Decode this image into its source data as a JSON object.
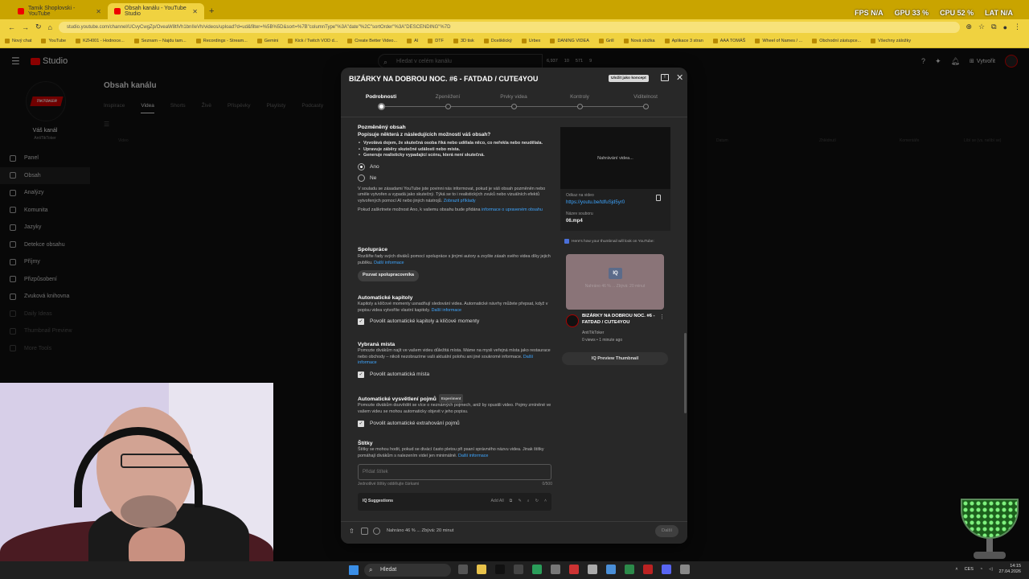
{
  "browser": {
    "tabs": [
      {
        "title": "Tamik Shoplovski - YouTube",
        "active": false
      },
      {
        "title": "Obsah kanálu - YouTube Studio",
        "active": true
      }
    ],
    "address": "studio.youtube.com/channel/UCvyCwgZp/OveaW8tlVh1bnIIeVh/videos/upload?d=ud&filter=%5B%5D&sort=%7B\"columnType\"%3A\"date\"%2C\"sortOrder\"%3A\"DESCENDING\"%7D",
    "hud": {
      "fps": "FPS N/A",
      "gpu": "GPU 33 %",
      "cpu": "CPU 52 %",
      "lat": "LAT N/A"
    },
    "bookmarks": [
      "Nový chat",
      "YouTube",
      "KZH001 - Hodnoce...",
      "Seznam – Najdu tam...",
      "Recordings - Stream...",
      "Gemini",
      "Kick / Twitch VOD d...",
      "Create Better Video...",
      "AI",
      "DTF",
      "3D tisk",
      "Dcešklický",
      "Urbex",
      "DANING VIDEA",
      "Grill",
      "Nová složka",
      "Aplikace 3 stran",
      "AAA TOMÁŠ",
      "Wheel of Names / ...",
      "Obchodní zástupce...",
      "Všechny záložky"
    ]
  },
  "studio": {
    "logo": "Studio",
    "search_placeholder": "Hledat v celém kanálu",
    "stats": [
      "6,937",
      "10",
      "571",
      "9"
    ],
    "create_label": "Vytvořit",
    "channel": {
      "label": "Váš kanál",
      "name": "AntiTikToker",
      "avatar_text": "TIKTOKER"
    },
    "nav": [
      {
        "label": "Panel"
      },
      {
        "label": "Obsah"
      },
      {
        "label": "Analýzy"
      },
      {
        "label": "Komunita"
      },
      {
        "label": "Jazyky"
      },
      {
        "label": "Detekce obsahu"
      },
      {
        "label": "Příjmy"
      },
      {
        "label": "Přizpůsobení"
      },
      {
        "label": "Zvuková knihovna"
      },
      {
        "label": "Daily Ideas"
      },
      {
        "label": "Thumbnail Preview"
      },
      {
        "label": "More Tools"
      }
    ],
    "page_title": "Obsah kanálu",
    "content_tabs": [
      "Inspirace",
      "Videa",
      "Shorts",
      "Živě",
      "Příspěvky",
      "Playlisty",
      "Podcasty"
    ],
    "table_headers": [
      "Video",
      "Datum",
      "Zhlédnutí",
      "Komentáře",
      "Líbí se (vs. nelíbí se)"
    ]
  },
  "modal": {
    "title": "BIZÁRKY NA DOBROU NOC. #6 - FATDAD / CUTE4YOU",
    "draft_badge": "Uložit jako koncept",
    "steps": [
      "Podrobnosti",
      "Zpeněžení",
      "Prvky videa",
      "Kontroly",
      "Viditelnost"
    ],
    "altered": {
      "heading": "Pozměněný obsah",
      "question": "Popisuje některá z následujících možností váš obsah?",
      "bullets": [
        "Vyvolává dojem, že skutečná osoba říká nebo udělala něco, co neřekla nebo neudělala.",
        "Upravuje záběry skutečné události nebo místa.",
        "Generuje realisticky vypadající scénu, která není skutečná."
      ],
      "yes": "Ano",
      "no": "Ne",
      "help1": "V souladu se zásadami YouTube jste povinni nás informovat, pokud je váš obsah pozměněn nebo uměle vytvořen a vypadá jako skutečný. Týká se to i realistických zvuků nebo vizuálních efektů vytvořených pomocí AI nebo jiných nástrojů.",
      "help1_link": "Zobrazit příklady",
      "help2": "Pokud zaškrtnete možnost Ano, k vašemu obsahu bude přidána",
      "help2_link": "informace o upraveném obsahu"
    },
    "collab": {
      "heading": "Spolupráce",
      "text": "Rozšiřte řady svých diváků pomocí spolupráce s jinými autory a zvyšte zásah svého videa díky jejich publiku.",
      "link": "Další informace",
      "button": "Pozvat spolupracovníka"
    },
    "chapters": {
      "heading": "Automatické kapitoly",
      "text": "Kapitoly a klíčové momenty usnadňují sledování videa. Automatické návrhy můžete přepsat, když v popisu videa vytvoříte vlastní kapitoly.",
      "link": "Další informace",
      "checkbox": "Povolit automatické kapitoly a klíčové momenty"
    },
    "places": {
      "heading": "Vybraná místa",
      "text": "Pomozte divákům najít ve vašem videu důležitá místa. Máme na mysli veřejná místa jako restaurace nebo obchody – nikoli nezobrazíme vaši aktuální polohu ani jiné soukromé informace.",
      "link": "Další informace",
      "checkbox": "Povolit automatická místa"
    },
    "concepts": {
      "heading": "Automatické vysvětlení pojmů",
      "badge": "Experiment",
      "text": "Pomozte divákům dozvědět se více o neznámých pojmech, aniž by opustili video. Pojmy zmíněné ve vašem videu se mohou automaticky objevit v jeho popisu.",
      "checkbox": "Povolit automatické extrahování pojmů"
    },
    "tags": {
      "heading": "Štítky",
      "text": "Štítky se mohou hodit, pokud se divácí často pletou při psaní správného názvu videa. Jinak štítky pomáhají divákům s nalezením videí jen minimálně.",
      "link": "Další informace",
      "placeholder": "Přidat štítek",
      "hint": "Jednotlivé štítky oddělujte čárkami",
      "counter": "0/500"
    },
    "suggestions": {
      "label": "Suggestions",
      "add_all": "Add All"
    },
    "preview": {
      "uploading": "Nahrávání videa...",
      "link_label": "Odkaz na video",
      "link": "https://youtu.be/tdfuSjd5yr0",
      "file_label": "Název souboru",
      "file": "06.mp4",
      "thumb_note": "Here's how your thumbnail will look on YouTube:",
      "thumb_badge": "IQ",
      "thumb_text": "Nahráno 46 % ... Zbývá: 20 minut",
      "card_title": "BIZÁRKY NA DOBROU NOC. #6 - FATDAD / CUTE4YOU",
      "card_channel": "AntiTikToker",
      "card_meta": "0 views • 1 minute ago",
      "preview_button": "Preview Thumbnail"
    },
    "footer": {
      "status": "Nahráno 46 % ... Zbývá: 20 minut",
      "next": "Další"
    },
    "progress": {
      "current_step": 0,
      "upload_percent": 46
    }
  },
  "taskbar": {
    "search": "Hledat",
    "lang": "CES",
    "time": "14:15",
    "date": "27.04.2026",
    "app_colors": [
      "#555",
      "#e8c24a",
      "#111",
      "#444",
      "#2a9d5a",
      "#777",
      "#c33",
      "#aaa",
      "#4a8fd8",
      "#2c8a4a",
      "#b22",
      "#5865f2",
      "#888"
    ]
  },
  "colors": {
    "accent_link": "#3ea6ff",
    "browser_chrome": "#f0d240",
    "brand_red": "#ff0000"
  }
}
